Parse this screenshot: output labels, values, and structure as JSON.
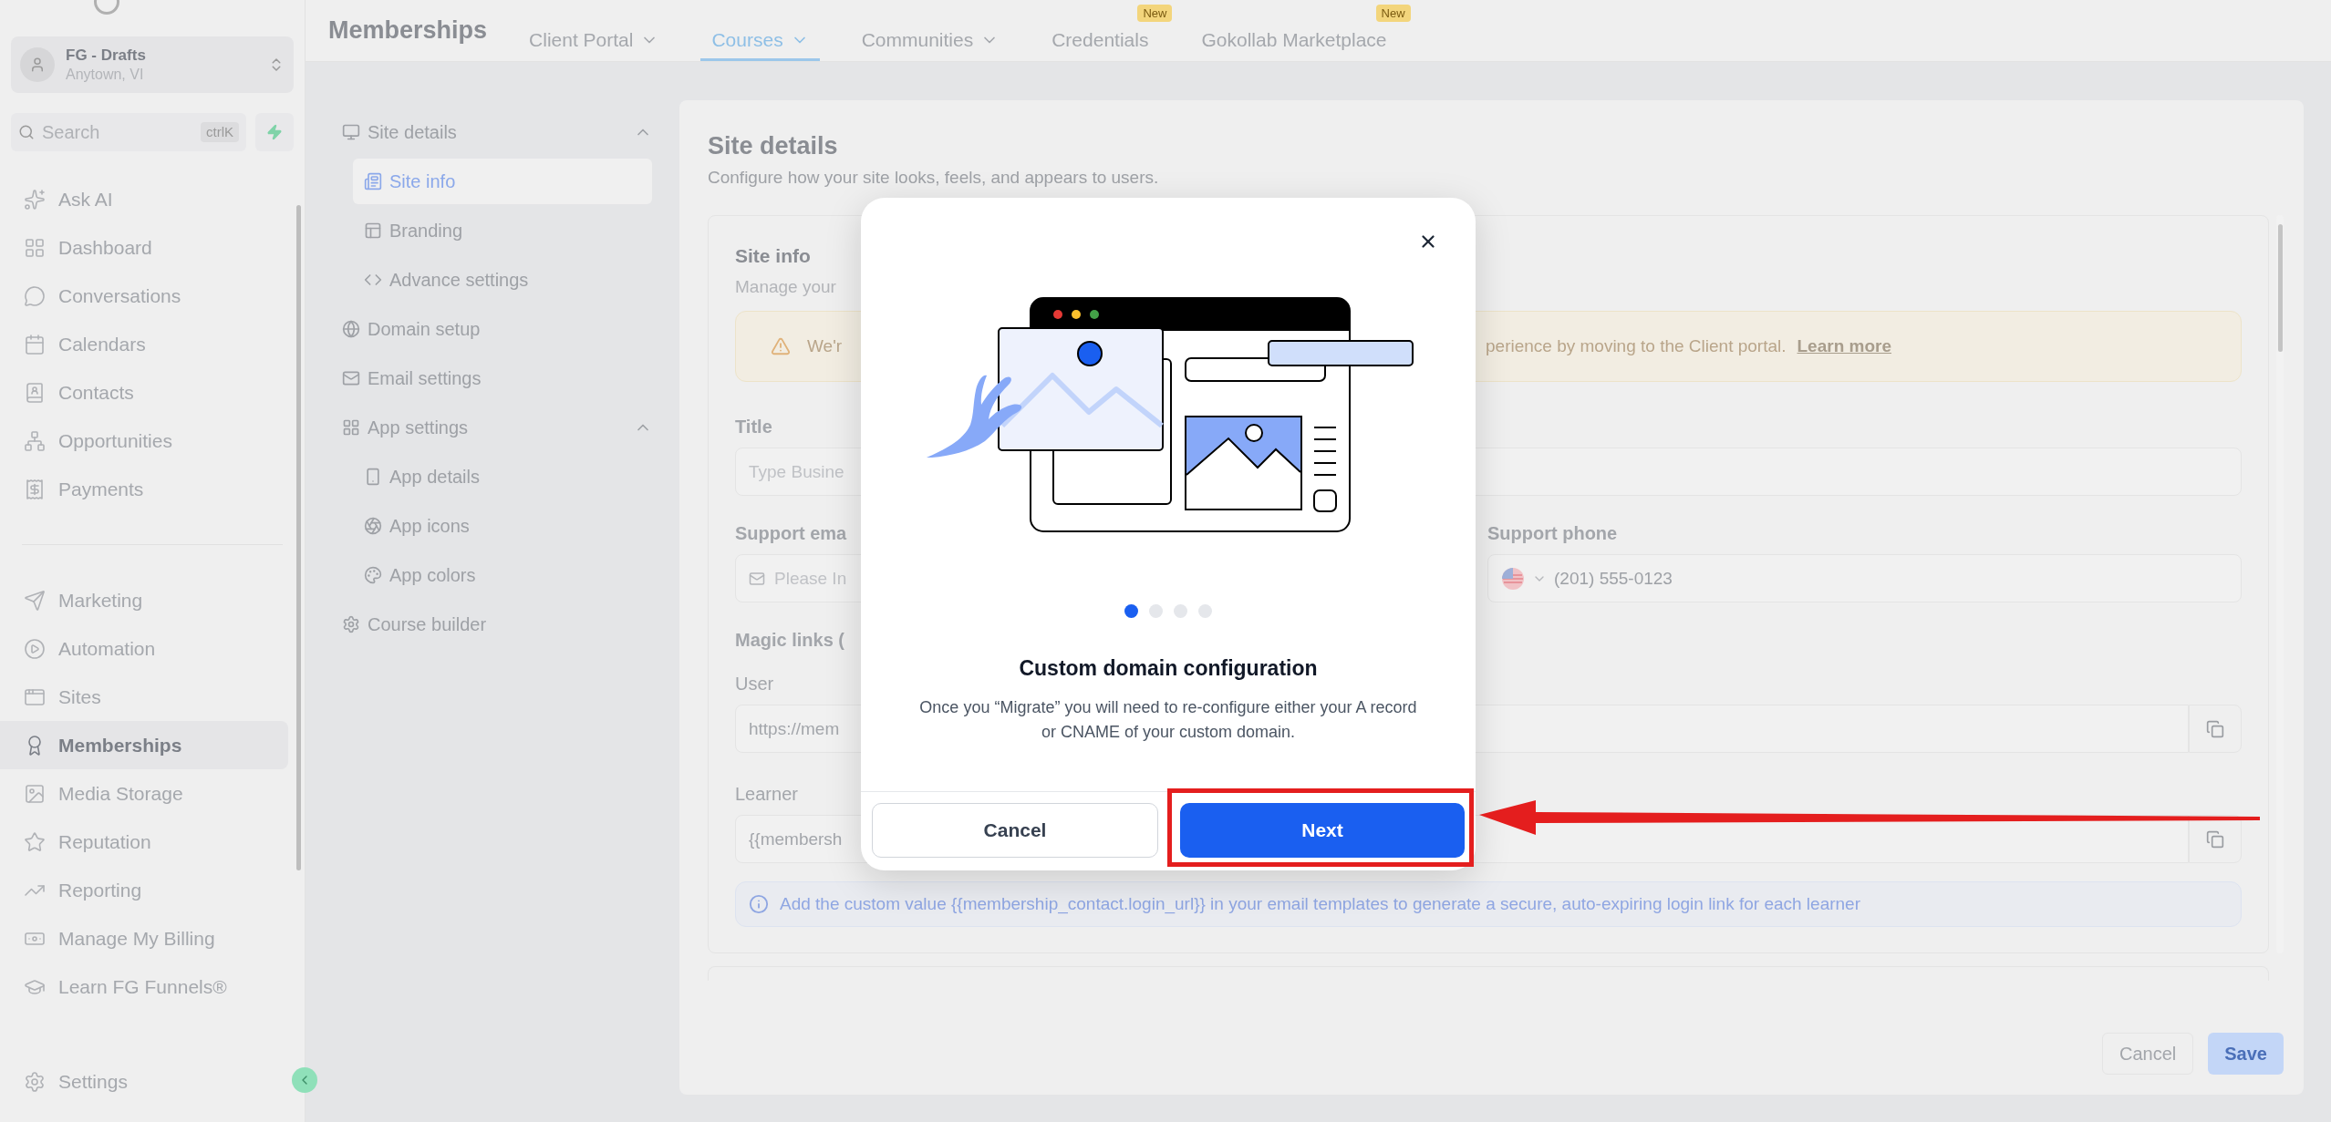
{
  "sidebar": {
    "account": {
      "name": "FG - Drafts",
      "location": "Anytown, VI"
    },
    "search": {
      "placeholder": "Search",
      "shortcut": "ctrlK"
    },
    "sections": [
      [
        {
          "label": "Ask AI",
          "selected": false
        },
        {
          "label": "Dashboard",
          "selected": false
        },
        {
          "label": "Conversations",
          "selected": false
        },
        {
          "label": "Calendars",
          "selected": false
        },
        {
          "label": "Contacts",
          "selected": false
        },
        {
          "label": "Opportunities",
          "selected": false
        },
        {
          "label": "Payments",
          "selected": false
        }
      ],
      [
        {
          "label": "Marketing",
          "selected": false
        },
        {
          "label": "Automation",
          "selected": false
        },
        {
          "label": "Sites",
          "selected": false
        },
        {
          "label": "Memberships",
          "selected": true
        },
        {
          "label": "Media Storage",
          "selected": false
        },
        {
          "label": "Reputation",
          "selected": false
        },
        {
          "label": "Reporting",
          "selected": false
        },
        {
          "label": "Manage My Billing",
          "selected": false
        },
        {
          "label": "Learn FG Funnels®",
          "selected": false
        }
      ]
    ],
    "settings": {
      "label": "Settings"
    }
  },
  "header": {
    "title": "Memberships",
    "tabs": [
      {
        "label": "Client Portal",
        "selected": false,
        "dropdown": true
      },
      {
        "label": "Courses",
        "selected": true,
        "dropdown": true
      },
      {
        "label": "Communities",
        "selected": false,
        "dropdown": true
      },
      {
        "label": "Credentials",
        "selected": false,
        "dropdown": false,
        "badge": "New"
      },
      {
        "label": "Gokollab Marketplace",
        "selected": false,
        "dropdown": false,
        "badge": "New"
      }
    ]
  },
  "settings_nav": [
    {
      "label": "Site details",
      "expanded": true,
      "children": [
        {
          "label": "Site info",
          "selected": true
        },
        {
          "label": "Branding",
          "selected": false
        },
        {
          "label": "Advance settings",
          "selected": false
        }
      ]
    },
    {
      "label": "Domain setup",
      "selected": false
    },
    {
      "label": "Email settings",
      "selected": false
    },
    {
      "label": "App settings",
      "expanded": true,
      "children": [
        {
          "label": "App details",
          "selected": false
        },
        {
          "label": "App icons",
          "selected": false
        },
        {
          "label": "App colors",
          "selected": false
        }
      ]
    },
    {
      "label": "Course builder",
      "selected": false
    }
  ],
  "main": {
    "title": "Site details",
    "subtitle": "Configure how your site looks, feels, and appears to users.",
    "section": {
      "title": "Site info",
      "subtitle": "Manage your",
      "banner": {
        "text_left": "We'r",
        "text_right": "perience by moving to the Client portal.",
        "link": "Learn more"
      },
      "title_label": "Title",
      "title_placeholder": "Type Busine",
      "email_label": "Support ema",
      "email_placeholder": "Please In",
      "phone_label": "Support phone",
      "phone_placeholder": "(201) 555-0123",
      "magic_links_label": "Magic links (",
      "user_label": "User",
      "user_value": "https://mem",
      "learner_label": "Learner",
      "learner_value": "{{membersh",
      "info": "Add the custom value {{membership_contact.login_url}} in your email templates to generate a secure, auto-expiring login link for each learner"
    },
    "footer": {
      "cancel": "Cancel",
      "save": "Save",
      "save_disabled": true
    }
  },
  "modal": {
    "steps": [
      {
        "selected": true
      },
      {
        "selected": false
      },
      {
        "selected": false
      },
      {
        "selected": false
      }
    ],
    "title": "Custom domain configuration",
    "body": "Once you “Migrate” you will need to re-configure either your A record or CNAME of your custom domain.",
    "cancel": "Cancel",
    "next": "Next"
  }
}
